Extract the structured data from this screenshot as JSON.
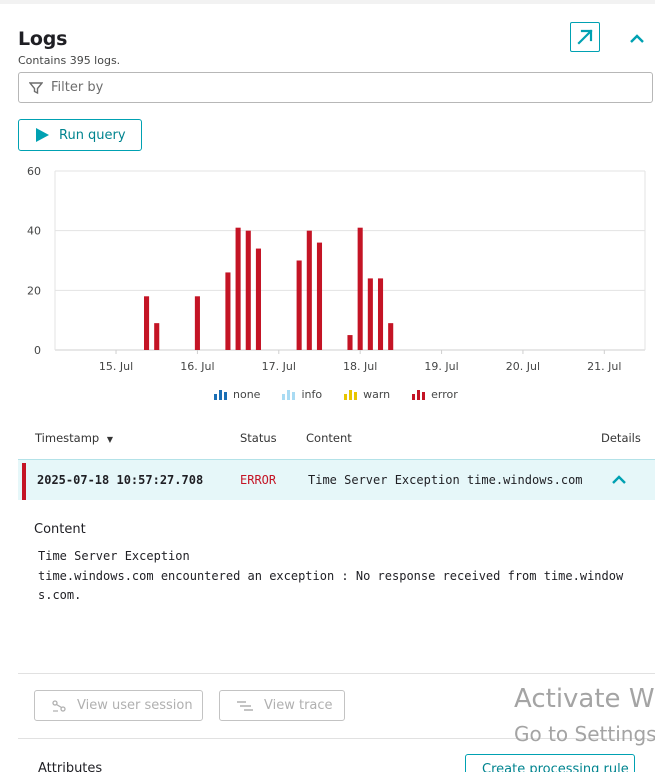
{
  "header": {
    "title": "Logs",
    "subtitle": "Contains 395 logs."
  },
  "filter": {
    "placeholder": "Filter by",
    "value": ""
  },
  "run_query": {
    "label": "Run query"
  },
  "chart_data": {
    "type": "bar",
    "ylim": [
      0,
      60
    ],
    "yticks": [
      0,
      20,
      40,
      60
    ],
    "xlim": [
      "2025-07-14T06:00",
      "2025-07-21T12:00"
    ],
    "xticks": [
      "15. Jul",
      "16. Jul",
      "17. Jul",
      "18. Jul",
      "19. Jul",
      "20. Jul",
      "21. Jul"
    ],
    "bar_width_hours": 1.5,
    "grid": true,
    "legend": "bottom",
    "series": [
      {
        "name": "none",
        "color": "#1a6fb5",
        "points": []
      },
      {
        "name": "info",
        "color": "#a9dbf3",
        "points": []
      },
      {
        "name": "warn",
        "color": "#e8c600",
        "points": []
      },
      {
        "name": "error",
        "color": "#c41425",
        "points": [
          {
            "x": "2025-07-15T09:00",
            "y": 18
          },
          {
            "x": "2025-07-15T12:00",
            "y": 9
          },
          {
            "x": "2025-07-16T00:00",
            "y": 18
          },
          {
            "x": "2025-07-16T09:00",
            "y": 26
          },
          {
            "x": "2025-07-16T12:00",
            "y": 41
          },
          {
            "x": "2025-07-16T15:00",
            "y": 40
          },
          {
            "x": "2025-07-16T18:00",
            "y": 34
          },
          {
            "x": "2025-07-17T06:00",
            "y": 30
          },
          {
            "x": "2025-07-17T09:00",
            "y": 40
          },
          {
            "x": "2025-07-17T12:00",
            "y": 36
          },
          {
            "x": "2025-07-17T21:00",
            "y": 5
          },
          {
            "x": "2025-07-18T00:00",
            "y": 41
          },
          {
            "x": "2025-07-18T03:00",
            "y": 24
          },
          {
            "x": "2025-07-18T06:00",
            "y": 24
          },
          {
            "x": "2025-07-18T09:00",
            "y": 9
          }
        ]
      }
    ]
  },
  "table": {
    "columns": {
      "timestamp": "Timestamp",
      "status": "Status",
      "content": "Content",
      "details": "Details"
    },
    "rows": [
      {
        "timestamp": "2025-07-18 10:57:27.708",
        "status": "ERROR",
        "content": "Time Server Exception time.windows.com encountered an exception : No response received from time.windows.com."
      }
    ]
  },
  "detail": {
    "content_label": "Content",
    "content_text": "Time Server Exception\ntime.windows.com encountered an exception : No response received from time.windows.com.",
    "view_user_session": "View user session",
    "view_trace": "View trace",
    "attributes_label": "Attributes",
    "create_rule": "Create processing rule"
  },
  "watermark": {
    "line1": "Activate W",
    "line2": "Go to Settings"
  },
  "colors": {
    "accent": "#00a1b2",
    "error": "#c41425",
    "row_highlight": "#e6f7f9"
  }
}
